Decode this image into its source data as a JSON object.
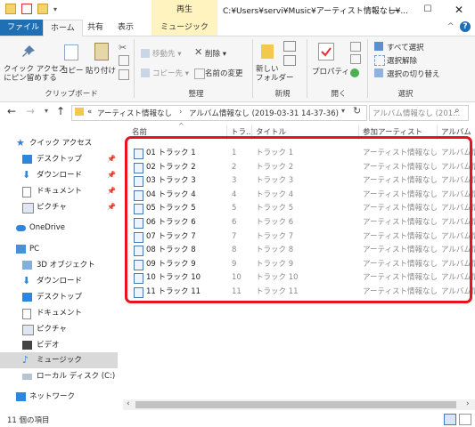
{
  "window": {
    "path_title": "C:¥Users¥servi¥Music¥アーティスト情報なし¥...",
    "context_tab_group": "再生",
    "controls": {
      "minimize": "—",
      "maximize": "☐",
      "close": "✕"
    }
  },
  "tabs": {
    "file": "ファイル",
    "home": "ホーム",
    "share": "共有",
    "view": "表示",
    "music_tools": "ミュージック ツール"
  },
  "ribbon": {
    "clipboard": {
      "label": "クリップボード",
      "pin_quick": "クイック アクセス\nにピン留めする",
      "copy": "コピー",
      "paste": "貼り付け"
    },
    "organize": {
      "label": "整理",
      "move_to": "移動先 ▾",
      "delete": "削除 ▾",
      "copy_to": "コピー先 ▾",
      "rename": "名前の変更"
    },
    "new": {
      "label": "新規",
      "new_folder": "新しい\nフォルダー"
    },
    "open": {
      "label": "開く",
      "properties": "プロパティ"
    },
    "select": {
      "label": "選択",
      "select_all": "すべて選択",
      "select_none": "選択解除",
      "invert": "選択の切り替え"
    }
  },
  "nav": {
    "back": "←",
    "forward": "→",
    "recent": "▾",
    "up": "↑",
    "breadcrumb_prefix": "«",
    "crumb1": "アーティスト情報なし",
    "crumb_sep": "›",
    "crumb2": "アルバム情報なし (2019-03-31 14-37-36)",
    "refresh": "↻",
    "search_placeholder": "アルバム情報なし (201..."
  },
  "sidebar": {
    "quick_access": "クイック アクセス",
    "items_quick": [
      {
        "label": "デスクトップ"
      },
      {
        "label": "ダウンロード"
      },
      {
        "label": "ドキュメント"
      },
      {
        "label": "ピクチャ"
      }
    ],
    "onedrive": "OneDrive",
    "pc": "PC",
    "items_pc": [
      {
        "label": "3D オブジェクト"
      },
      {
        "label": "ダウンロード"
      },
      {
        "label": "デスクトップ"
      },
      {
        "label": "ドキュメント"
      },
      {
        "label": "ピクチャ"
      },
      {
        "label": "ビデオ"
      },
      {
        "label": "ミュージック"
      },
      {
        "label": "ローカル ディスク (C:)"
      }
    ],
    "network": "ネットワーク"
  },
  "columns": {
    "name": "名前",
    "track": "トラ...",
    "title": "タイトル",
    "artist": "参加アーティスト",
    "album": "アルバム"
  },
  "files": [
    {
      "name": "01 トラック 1",
      "track": "1",
      "title": "トラック 1",
      "artist": "アーティスト情報なし",
      "album": "アルバム情"
    },
    {
      "name": "02 トラック 2",
      "track": "2",
      "title": "トラック 2",
      "artist": "アーティスト情報なし",
      "album": "アルバム情"
    },
    {
      "name": "03 トラック 3",
      "track": "3",
      "title": "トラック 3",
      "artist": "アーティスト情報なし",
      "album": "アルバム情"
    },
    {
      "name": "04 トラック 4",
      "track": "4",
      "title": "トラック 4",
      "artist": "アーティスト情報なし",
      "album": "アルバム情"
    },
    {
      "name": "05 トラック 5",
      "track": "5",
      "title": "トラック 5",
      "artist": "アーティスト情報なし",
      "album": "アルバム情"
    },
    {
      "name": "06 トラック 6",
      "track": "6",
      "title": "トラック 6",
      "artist": "アーティスト情報なし",
      "album": "アルバム情"
    },
    {
      "name": "07 トラック 7",
      "track": "7",
      "title": "トラック 7",
      "artist": "アーティスト情報なし",
      "album": "アルバム情"
    },
    {
      "name": "08 トラック 8",
      "track": "8",
      "title": "トラック 8",
      "artist": "アーティスト情報なし",
      "album": "アルバム情"
    },
    {
      "name": "09 トラック 9",
      "track": "9",
      "title": "トラック 9",
      "artist": "アーティスト情報なし",
      "album": "アルバム情"
    },
    {
      "name": "10 トラック 10",
      "track": "10",
      "title": "トラック 10",
      "artist": "アーティスト情報なし",
      "album": "アルバム情"
    },
    {
      "name": "11 トラック 11",
      "track": "11",
      "title": "トラック 11",
      "artist": "アーティスト情報なし",
      "album": "アルバム情"
    }
  ],
  "status": {
    "item_count": "11 個の項目"
  },
  "colors": {
    "accent": "#1f6fb5",
    "context_band": "#fff3bf",
    "highlight_border": "#e8131e",
    "selected_nav": "#d9d9d9"
  }
}
